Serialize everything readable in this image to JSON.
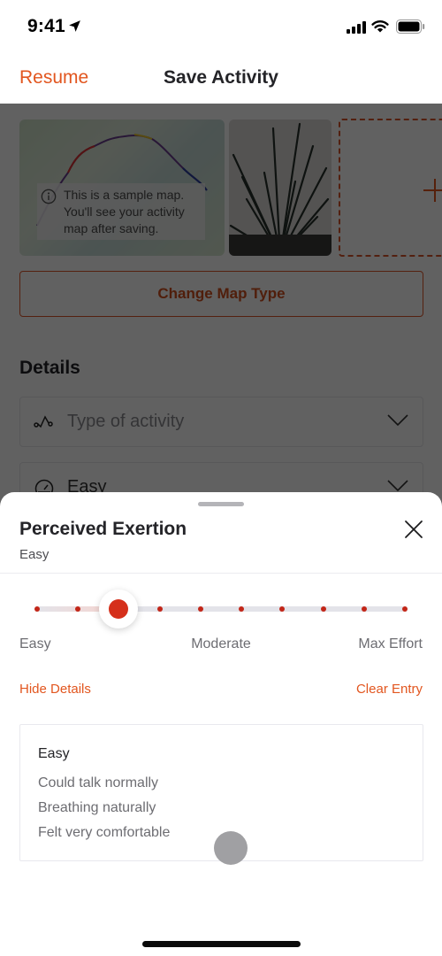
{
  "status_bar": {
    "time": "9:41",
    "icons": [
      "location-arrow-icon",
      "cellular-signal-icon",
      "wifi-icon",
      "battery-icon"
    ]
  },
  "nav": {
    "back_label": "Resume",
    "title": "Save Activity"
  },
  "media": {
    "map_note": "This is a sample map. You'll see your activity map after saving.",
    "add_media_icon": "plus-icon",
    "change_map_type_label": "Change Map Type"
  },
  "details": {
    "heading": "Details",
    "fields": [
      {
        "icon": "activity-type-icon",
        "text": "Type of activity",
        "is_placeholder": true
      },
      {
        "icon": "speedometer-icon",
        "text": "Easy",
        "is_placeholder": false
      }
    ]
  },
  "sheet": {
    "title": "Perceived Exertion",
    "subtitle": "Easy",
    "close_icon": "close-icon",
    "slider": {
      "steps": 10,
      "selected_index": 2,
      "selected_value": 3,
      "labels": {
        "min": "Easy",
        "mid": "Moderate",
        "max": "Max Effort"
      }
    },
    "hide_details_label": "Hide Details",
    "clear_entry_label": "Clear Entry",
    "detail_box": {
      "title": "Easy",
      "lines": [
        "Could talk normally",
        "Breathing naturally",
        "Felt very comfortable"
      ]
    }
  },
  "colors": {
    "accent": "#e2561f",
    "slider_active": "#d5301b",
    "slider_dot": "#c22618",
    "text_primary": "#242428",
    "text_secondary": "#6d6d72"
  }
}
